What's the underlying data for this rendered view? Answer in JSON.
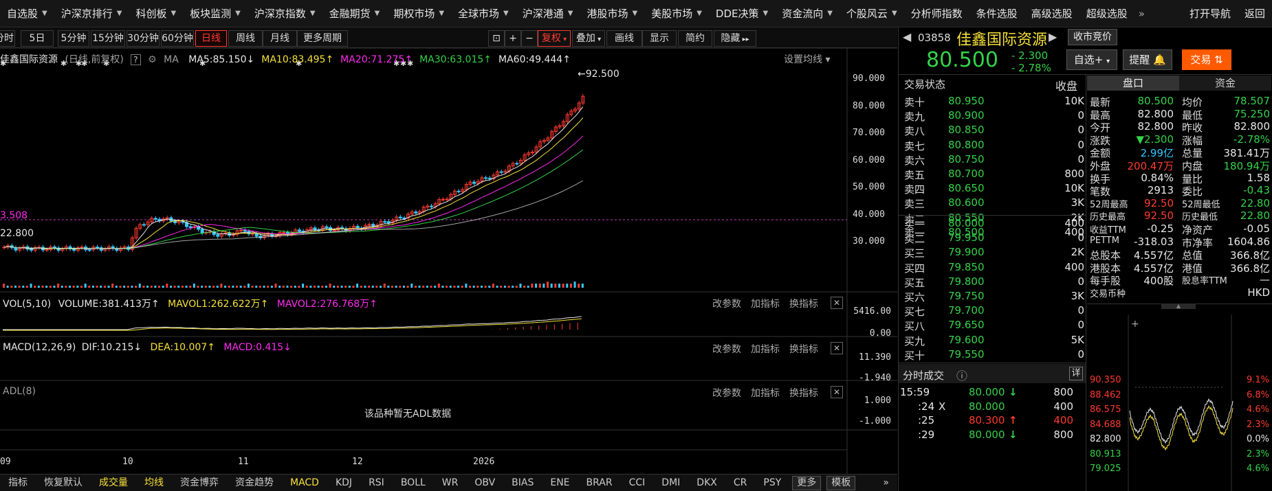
{
  "menu": [
    {
      "label": "自选股",
      "caret": true
    },
    {
      "label": "沪深京排行",
      "caret": true
    },
    {
      "label": "科创板",
      "caret": true
    },
    {
      "label": "板块监测",
      "caret": true
    },
    {
      "label": "沪深京指数",
      "caret": true
    },
    {
      "label": "金融期货",
      "caret": true
    },
    {
      "label": "期权市场",
      "caret": true
    },
    {
      "label": "全球市场",
      "caret": true
    },
    {
      "label": "沪深港通",
      "caret": true
    },
    {
      "label": "港股市场",
      "caret": true
    },
    {
      "label": "美股市场",
      "caret": true
    },
    {
      "label": "DDE决策",
      "caret": true
    },
    {
      "label": "资金流向",
      "caret": true
    },
    {
      "label": "个股风云",
      "caret": true
    },
    {
      "label": "分析师指数",
      "caret": false
    },
    {
      "label": "条件选股",
      "caret": false
    },
    {
      "label": "高级选股",
      "caret": false
    },
    {
      "label": "超级选股",
      "caret": false
    }
  ],
  "menu_more": "»",
  "menu_right": [
    "打开导航",
    "返回"
  ],
  "toolbar": {
    "periods": [
      "分时",
      "5日",
      "5分钟",
      "15分钟",
      "30分钟",
      "60分钟",
      "日线",
      "周线",
      "月线",
      "更多周期"
    ],
    "active_period": "日线",
    "tools": [
      "复权",
      "叠加",
      "画线",
      "显示",
      "简约",
      "隐藏"
    ]
  },
  "chart": {
    "stock_label": "佳鑫国际资源",
    "period_note": "(日线,前复权)",
    "help": "?",
    "ma_label": "MA",
    "ma_values": [
      {
        "label": "MA5:85.150",
        "arrow": "↓",
        "color": "#e8e8e8"
      },
      {
        "label": "MA10:83.495",
        "arrow": "↑",
        "color": "#f7e13a"
      },
      {
        "label": "MA20:71.275",
        "arrow": "↑",
        "color": "#ff2cf0"
      },
      {
        "label": "MA30:63.015",
        "arrow": "↑",
        "color": "#35d24a"
      },
      {
        "label": "MA60:49.444",
        "arrow": "↑",
        "color": "#e8e8e8"
      }
    ],
    "ma_settings": "设置均线",
    "high_marker": "92.500",
    "low_marker": "22.800",
    "left_marker": "3.508",
    "price_ticks": [
      "90.000",
      "80.000",
      "70.000",
      "60.000",
      "50.000",
      "40.000",
      "30.000"
    ],
    "vol_header": {
      "name": "VOL(5,10)",
      "volume": "VOLUME:381.413万",
      "mavol1": "MAVOL1:262.622万",
      "mavol2": "MAVOL2:276.768万"
    },
    "vol_ticks": [
      "5416.00",
      "0.00"
    ],
    "macd_header": {
      "name": "MACD(12,26,9)",
      "dif": "DIF:10.215",
      "dea": "DEA:10.007",
      "macd": "MACD:0.415"
    },
    "macd_ticks": [
      "11.390",
      "-1.940"
    ],
    "adl_header": "ADL(8)",
    "adl_ticks": [
      "1.000",
      "-1.000"
    ],
    "adl_empty": "该品种暂无ADL数据",
    "panel_buttons": [
      "改参数",
      "加指标",
      "换指标"
    ],
    "date_ticks": [
      "09",
      "10",
      "11",
      "12",
      "2026"
    ]
  },
  "bottom_tabs": [
    "指标",
    "恢复默认",
    "成交量",
    "均线",
    "资金博弈",
    "资金趋势",
    "MACD",
    "KDJ",
    "RSI",
    "BOLL",
    "WR",
    "OBV",
    "BIAS",
    "ENE",
    "BRAR",
    "CCI",
    "DMI",
    "DKX",
    "CR",
    "PSY",
    "更多",
    "模板"
  ],
  "stock": {
    "code": "03858",
    "name": "佳鑫国际资源",
    "auction_btn": "收市竞价",
    "price": "80.500",
    "change": "- 2.300",
    "change_pct": "- 2.78%",
    "watch_btn": "自选+",
    "alert_btn": "提醒",
    "trade_btn": "交易"
  },
  "orderbook": {
    "title": "交易状态",
    "status": "收盘",
    "asks": [
      {
        "label": "卖十",
        "price": "80.950",
        "vol": "10K"
      },
      {
        "label": "卖九",
        "price": "80.900",
        "vol": "0"
      },
      {
        "label": "卖八",
        "price": "80.850",
        "vol": "0"
      },
      {
        "label": "卖七",
        "price": "80.800",
        "vol": "0"
      },
      {
        "label": "卖六",
        "price": "80.750",
        "vol": "0"
      },
      {
        "label": "卖五",
        "price": "80.700",
        "vol": "800"
      },
      {
        "label": "卖四",
        "price": "80.650",
        "vol": "10K"
      },
      {
        "label": "卖三",
        "price": "80.600",
        "vol": "3K"
      },
      {
        "label": "卖二",
        "price": "80.550",
        "vol": "2K"
      },
      {
        "label": "卖一",
        "price": "80.500",
        "vol": "400"
      }
    ],
    "bids": [
      {
        "label": "买一",
        "price": "80.000",
        "vol": "400"
      },
      {
        "label": "买二",
        "price": "79.950",
        "vol": "0"
      },
      {
        "label": "买三",
        "price": "79.900",
        "vol": "2K"
      },
      {
        "label": "买四",
        "price": "79.850",
        "vol": "400"
      },
      {
        "label": "买五",
        "price": "79.800",
        "vol": "0"
      },
      {
        "label": "买六",
        "price": "79.750",
        "vol": "3K"
      },
      {
        "label": "买七",
        "price": "79.700",
        "vol": "0"
      },
      {
        "label": "买八",
        "price": "79.650",
        "vol": "0"
      },
      {
        "label": "买九",
        "price": "79.600",
        "vol": "5K"
      },
      {
        "label": "买十",
        "price": "79.550",
        "vol": "0"
      }
    ]
  },
  "ticks": {
    "title": "分时成交",
    "detail_btn": "详",
    "rows": [
      {
        "time": "15:59",
        "flag": "",
        "price": "80.000",
        "dir": "↓",
        "vol": "800",
        "color": "#35d24a"
      },
      {
        "time": ":24",
        "flag": "X",
        "price": "80.000",
        "dir": "",
        "vol": "400",
        "color": "#35d24a"
      },
      {
        "time": ":25",
        "flag": "",
        "price": "80.300",
        "dir": "↑",
        "vol": "400",
        "color": "#ff3b30"
      },
      {
        "time": ":29",
        "flag": "",
        "price": "80.000",
        "dir": "↓",
        "vol": "800",
        "color": "#35d24a"
      }
    ]
  },
  "quote_tabs": [
    "盘口",
    "资金"
  ],
  "quote": [
    {
      "l1": "最新",
      "v1": "80.500",
      "c1": "#35d24a",
      "l2": "均价",
      "v2": "78.507",
      "c2": "#35d24a"
    },
    {
      "l1": "最高",
      "v1": "82.800",
      "c1": "#e8e8e8",
      "l2": "最低",
      "v2": "75.250",
      "c2": "#35d24a"
    },
    {
      "l1": "今开",
      "v1": "82.800",
      "c1": "#e8e8e8",
      "l2": "昨收",
      "v2": "82.800",
      "c2": "#e8e8e8"
    },
    {
      "l1": "涨跌",
      "v1": "▼2.300",
      "c1": "#35d24a",
      "l2": "涨幅",
      "v2": "-2.78%",
      "c2": "#35d24a"
    },
    {
      "l1": "金额",
      "v1": "2.99亿",
      "c1": "#35c9ff",
      "l2": "总量",
      "v2": "381.41万",
      "c2": "#e8e8e8"
    },
    {
      "l1": "外盘",
      "v1": "200.47万",
      "c1": "#ff3b30",
      "l2": "内盘",
      "v2": "180.94万",
      "c2": "#35d24a"
    },
    {
      "l1": "换手",
      "v1": "0.84%",
      "c1": "#e8e8e8",
      "l2": "量比",
      "v2": "1.58",
      "c2": "#e8e8e8"
    },
    {
      "l1": "笔数",
      "v1": "2913",
      "c1": "#e8e8e8",
      "l2": "委比",
      "v2": "-0.43",
      "c2": "#35d24a"
    },
    {
      "l1": "52周最高",
      "v1": "92.50",
      "c1": "#ff3b30",
      "l2": "52周最低",
      "v2": "22.80",
      "c2": "#35d24a"
    },
    {
      "l1": "历史最高",
      "v1": "92.50",
      "c1": "#ff3b30",
      "l2": "历史最低",
      "v2": "22.80",
      "c2": "#35d24a"
    },
    {
      "l1": "收益TTM",
      "v1": "-0.25",
      "c1": "#e8e8e8",
      "l2": "净资产",
      "v2": "-0.05",
      "c2": "#e8e8e8"
    },
    {
      "l1": "PETTM",
      "v1": "-318.03",
      "c1": "#e8e8e8",
      "l2": "市净率",
      "v2": "1604.86",
      "c2": "#e8e8e8"
    },
    {
      "l1": "总股本",
      "v1": "4.557亿",
      "c1": "#e8e8e8",
      "l2": "总值",
      "v2": "366.8亿",
      "c2": "#e8e8e8"
    },
    {
      "l1": "港股本",
      "v1": "4.557亿",
      "c1": "#e8e8e8",
      "l2": "港值",
      "v2": "366.8亿",
      "c2": "#e8e8e8"
    },
    {
      "l1": "每手股",
      "v1": "400股",
      "c1": "#e8e8e8",
      "l2": "股息率TTM",
      "v2": "—",
      "c2": "#e8e8e8"
    },
    {
      "l1": "交易币种",
      "v1": "",
      "c1": "#e8e8e8",
      "l2": "",
      "v2": "HKD",
      "c2": "#e8e8e8"
    }
  ],
  "mini_chart": {
    "left_ticks": [
      "90.350",
      "88.462",
      "86.575",
      "84.688",
      "82.800",
      "80.913",
      "79.025"
    ],
    "right_ticks": [
      "9.1%",
      "6.8%",
      "4.6%",
      "2.3%",
      "0.0%",
      "2.3%",
      "4.6%"
    ]
  },
  "colors": {
    "up": "#ff3b30",
    "down": "#35d24a",
    "accent": "#ff5a00",
    "cyan": "#35c9ff"
  }
}
